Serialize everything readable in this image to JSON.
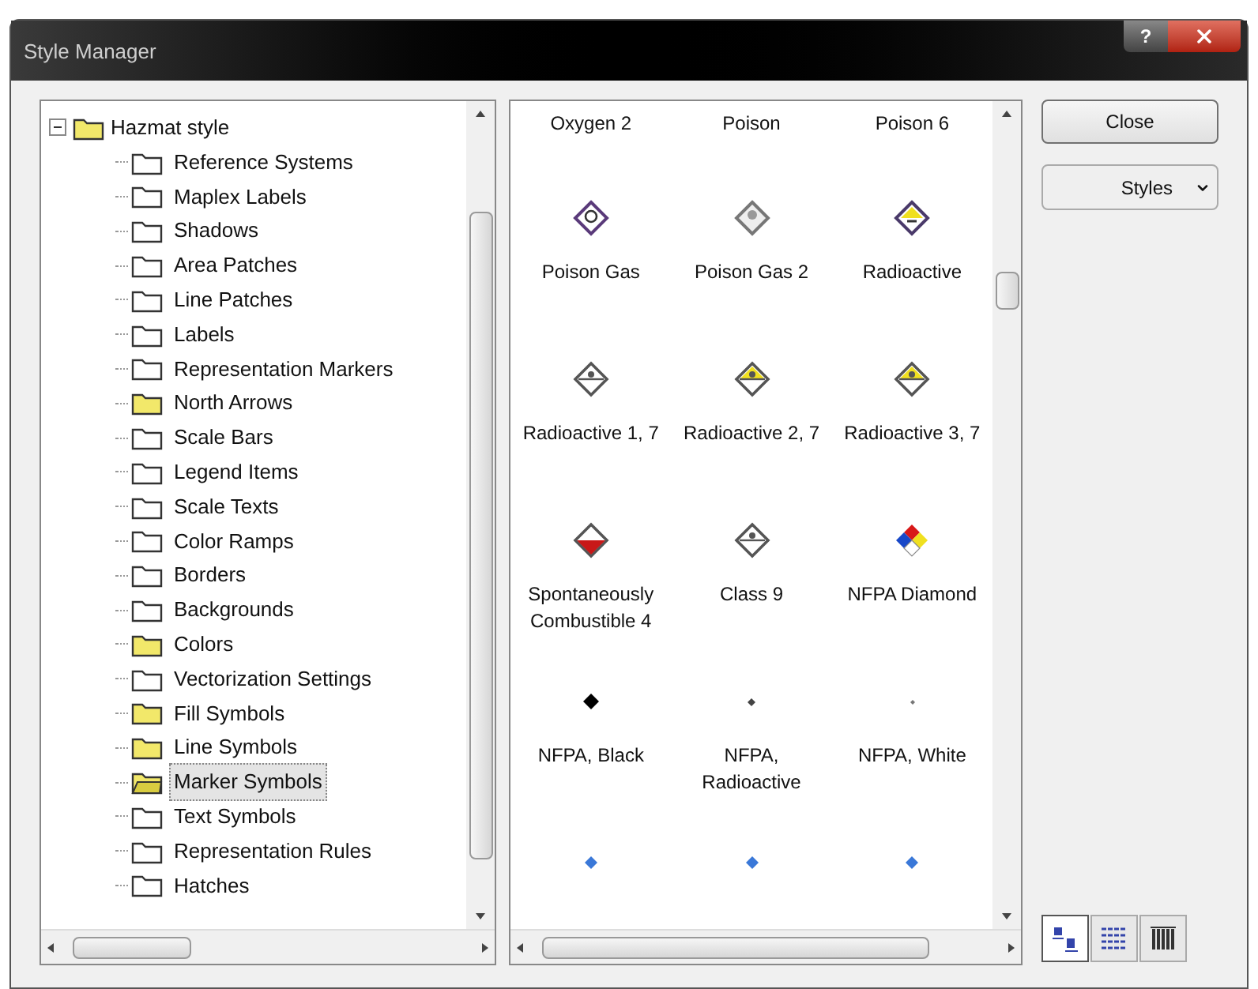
{
  "window": {
    "title": "Style Manager",
    "help_button": "?"
  },
  "tree": {
    "root": {
      "label": "Hazmat style",
      "expanded": true,
      "children": [
        {
          "label": "Reference Systems",
          "has_items": false,
          "selected": false
        },
        {
          "label": "Maplex Labels",
          "has_items": false,
          "selected": false
        },
        {
          "label": "Shadows",
          "has_items": false,
          "selected": false
        },
        {
          "label": "Area Patches",
          "has_items": false,
          "selected": false
        },
        {
          "label": "Line Patches",
          "has_items": false,
          "selected": false
        },
        {
          "label": "Labels",
          "has_items": false,
          "selected": false
        },
        {
          "label": "Representation Markers",
          "has_items": false,
          "selected": false
        },
        {
          "label": "North Arrows",
          "has_items": true,
          "selected": false
        },
        {
          "label": "Scale Bars",
          "has_items": false,
          "selected": false
        },
        {
          "label": "Legend Items",
          "has_items": false,
          "selected": false
        },
        {
          "label": "Scale Texts",
          "has_items": false,
          "selected": false
        },
        {
          "label": "Color Ramps",
          "has_items": false,
          "selected": false
        },
        {
          "label": "Borders",
          "has_items": false,
          "selected": false
        },
        {
          "label": "Backgrounds",
          "has_items": false,
          "selected": false
        },
        {
          "label": "Colors",
          "has_items": true,
          "selected": false
        },
        {
          "label": "Vectorization Settings",
          "has_items": false,
          "selected": false
        },
        {
          "label": "Fill Symbols",
          "has_items": true,
          "selected": false
        },
        {
          "label": "Line Symbols",
          "has_items": true,
          "selected": false
        },
        {
          "label": "Marker Symbols",
          "has_items": true,
          "selected": true
        },
        {
          "label": "Text Symbols",
          "has_items": false,
          "selected": false
        },
        {
          "label": "Representation Rules",
          "has_items": false,
          "selected": false
        },
        {
          "label": "Hatches",
          "has_items": false,
          "selected": false
        }
      ]
    }
  },
  "symbols": [
    [
      {
        "label": "Oxygen 2"
      },
      {
        "label": "Poison"
      },
      {
        "label": "Poison 6"
      }
    ],
    [
      {
        "kind": "purple-diamond",
        "label": "Poison Gas"
      },
      {
        "kind": "grey-diamond",
        "label": "Poison Gas 2"
      },
      {
        "kind": "yellow-diamond",
        "label": "Radioactive"
      }
    ],
    [
      {
        "kind": "white-radiation",
        "label": "Radioactive 1, 7"
      },
      {
        "kind": "yellow-radiation",
        "label": "Radioactive 2, 7"
      },
      {
        "kind": "yellow-radiation",
        "label": "Radioactive 3, 7"
      }
    ],
    [
      {
        "kind": "red-diamond",
        "label": "Spontaneously Combustible 4"
      },
      {
        "kind": "white-radiation",
        "label": "Class 9"
      },
      {
        "kind": "nfpa",
        "label": "NFPA Diamond"
      }
    ],
    [
      {
        "kind": "black-dot",
        "label": "NFPA, Black"
      },
      {
        "kind": "small-dot",
        "label": "NFPA, Radioactive"
      },
      {
        "kind": "tiny-dot",
        "label": "NFPA, White"
      }
    ],
    [
      {
        "kind": "blue-dot"
      },
      {
        "kind": "blue-dot"
      },
      {
        "kind": "blue-dot"
      }
    ]
  ],
  "buttons": {
    "close": "Close",
    "styles": "Styles"
  },
  "view_modes": [
    {
      "kind": "icons",
      "selected": true
    },
    {
      "kind": "list",
      "selected": false
    },
    {
      "kind": "details",
      "selected": false
    }
  ]
}
